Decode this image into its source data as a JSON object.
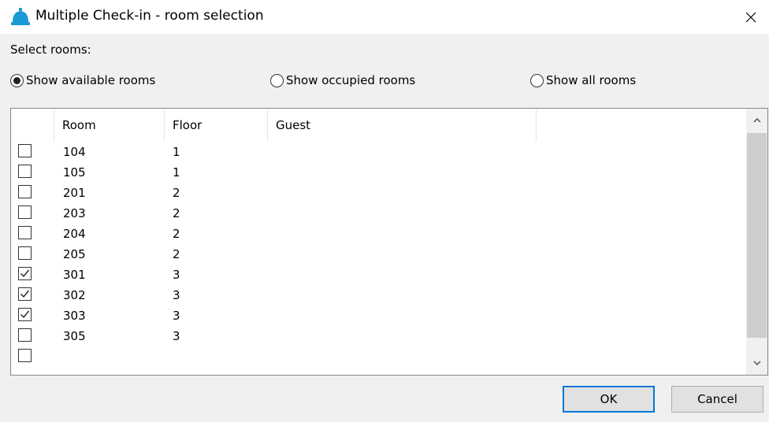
{
  "window": {
    "title": "Multiple Check-in - room selection"
  },
  "select_label": "Select rooms:",
  "filters": [
    {
      "label": "Show available rooms",
      "selected": true
    },
    {
      "label": "Show occupied rooms",
      "selected": false
    },
    {
      "label": "Show all rooms",
      "selected": false
    }
  ],
  "table": {
    "columns": [
      "Room",
      "Floor",
      "Guest"
    ],
    "rows": [
      {
        "checked": false,
        "room": "104",
        "floor": "1",
        "guest": ""
      },
      {
        "checked": false,
        "room": "105",
        "floor": "1",
        "guest": ""
      },
      {
        "checked": false,
        "room": "201",
        "floor": "2",
        "guest": ""
      },
      {
        "checked": false,
        "room": "203",
        "floor": "2",
        "guest": ""
      },
      {
        "checked": false,
        "room": "204",
        "floor": "2",
        "guest": ""
      },
      {
        "checked": false,
        "room": "205",
        "floor": "2",
        "guest": ""
      },
      {
        "checked": true,
        "room": "301",
        "floor": "3",
        "guest": ""
      },
      {
        "checked": true,
        "room": "302",
        "floor": "3",
        "guest": ""
      },
      {
        "checked": true,
        "room": "303",
        "floor": "3",
        "guest": ""
      },
      {
        "checked": false,
        "room": "305",
        "floor": "3",
        "guest": ""
      },
      {
        "checked": false,
        "room": "",
        "floor": "",
        "guest": ""
      }
    ]
  },
  "buttons": {
    "ok": "OK",
    "cancel": "Cancel"
  },
  "colors": {
    "accent": "#0078d7",
    "icon": "#1a9ad6"
  },
  "icons": {
    "app": "bell-icon",
    "close": "close-icon"
  }
}
